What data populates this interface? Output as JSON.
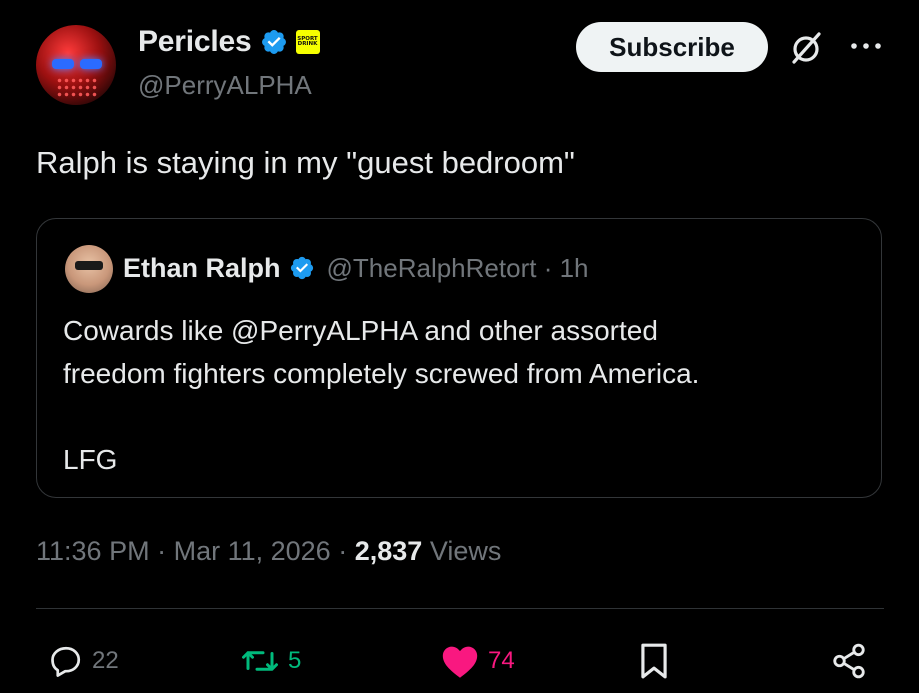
{
  "author": {
    "display_name": "Pericles",
    "handle": "@PerryALPHA",
    "affiliation_badge": "SPORT\nDRINK",
    "verified_color": "#1d9bf0",
    "badge_color": "#f6ff00"
  },
  "header": {
    "subscribe_label": "Subscribe",
    "grok_icon": "grok-icon",
    "more_icon": "more-horizontal-icon"
  },
  "tweet": {
    "text": "Ralph is staying in my \"guest bedroom\"",
    "time": "11:36 PM",
    "date": "Mar 11, 2026",
    "views_count": "2,837",
    "views_label": "Views"
  },
  "quote": {
    "display_name": "Ethan Ralph",
    "handle": "@TheRalphRetort",
    "age": "1h",
    "lines": [
      "Cowards like @PerryALPHA and other assorted",
      "freedom fighters completely screwed from America."
    ],
    "closing": "LFG"
  },
  "actions": {
    "replies": "22",
    "reposts": "5",
    "likes": "74",
    "reply_icon": "reply-icon",
    "repost_icon": "repost-icon",
    "like_icon": "heart-icon",
    "bookmark_icon": "bookmark-icon",
    "share_icon": "share-icon",
    "repost_color": "#00ba7c",
    "like_color": "#f91880"
  },
  "theme": {
    "background": "#000000",
    "text": "#e7e9ea",
    "secondary": "#71767b",
    "border": "#333639"
  }
}
